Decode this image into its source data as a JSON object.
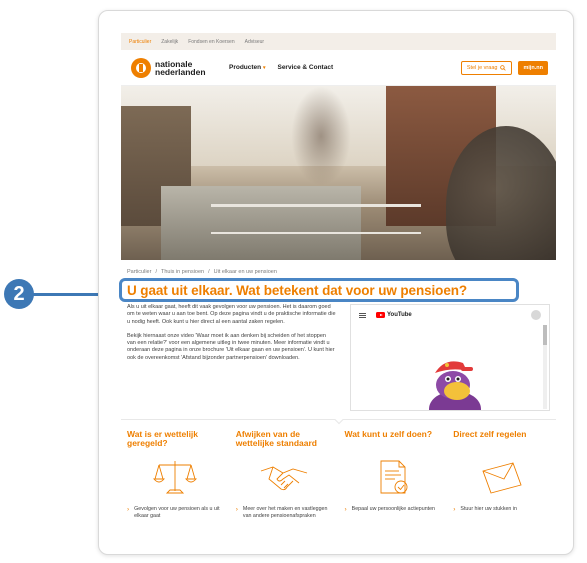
{
  "topbar": {
    "items": [
      "Particulier",
      "Zakelijk",
      "Fondsen en Koersen",
      "Adviseur"
    ]
  },
  "header": {
    "logo_text": "nationale nederlanden",
    "nav": [
      {
        "label": "Producten"
      },
      {
        "label": "Service & Contact"
      }
    ],
    "ask_label": "Stel je vraag",
    "mijn_label": "mijn.nn"
  },
  "breadcrumb": [
    "Particulier",
    "/",
    "Thuis in pensioen",
    "/",
    "Uit elkaar en uw pensioen"
  ],
  "title": "U gaat uit elkaar. Wat betekent dat voor uw pensioen?",
  "body": {
    "p1": "Als u uit elkaar gaat, heeft dit vaak gevolgen voor uw pensioen. Het is daarom goed om te weten waar u aan toe bent. Op deze pagina vindt u de praktische informatie die u nodig heeft. Ook kunt u hier direct al een aantal zaken regelen.",
    "p2": "Bekijk hiernaast onze video 'Waar moet ik aan denken bij scheiden of het stoppen van een relatie?' voor een algemene uitleg in twee minuten. Meer informatie vindt u onderaan deze pagina in onze brochure 'Uit elkaar gaan en uw pensioen'. U kunt hier ook de overeenkomst 'Afstand bijzonder partnerpensioen' downloaden."
  },
  "video": {
    "brand": "YouTube"
  },
  "cards": [
    {
      "title": "Wat is er wettelijk geregeld?",
      "icon": "scales-icon",
      "link": "Gevolgen voor uw pensioen als u uit elkaar gaat"
    },
    {
      "title": "Afwijken van de wettelijke standaard",
      "icon": "handshake-icon",
      "link": "Meer over het maken en vastleggen van andere pensioenafspraken"
    },
    {
      "title": "Wat kunt u zelf doen?",
      "icon": "document-check-icon",
      "link": "Bepaal uw persoonlijke actiepunten"
    },
    {
      "title": "Direct zelf regelen",
      "icon": "envelope-icon",
      "link": "Stuur hier uw stukken in"
    }
  ],
  "annotation": {
    "number": "2"
  },
  "colors": {
    "brand_orange": "#ee7f00",
    "annotation_blue": "#3d78b5"
  }
}
